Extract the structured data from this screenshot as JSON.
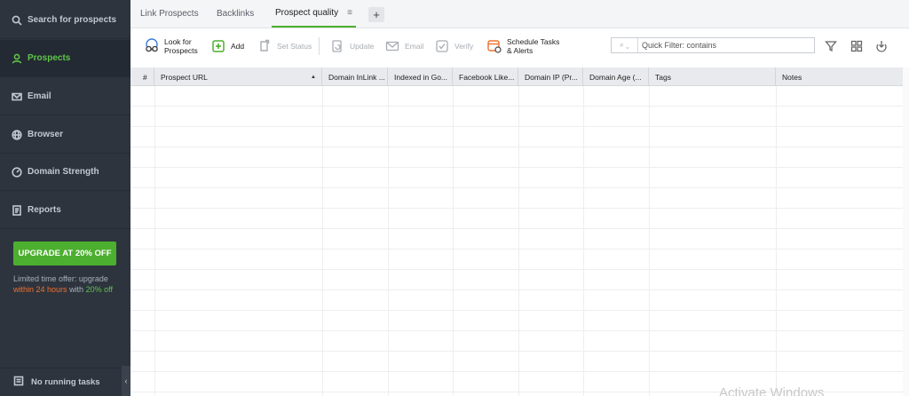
{
  "sidebar": {
    "items": [
      {
        "label": "Search for prospects",
        "icon": "search-icon"
      },
      {
        "label": "Prospects",
        "icon": "user-icon",
        "active": true
      },
      {
        "label": "Email",
        "icon": "mail-icon"
      },
      {
        "label": "Browser",
        "icon": "globe-icon"
      },
      {
        "label": "Domain Strength",
        "icon": "gauge-icon"
      },
      {
        "label": "Reports",
        "icon": "report-icon"
      }
    ],
    "upgrade_button": "UPGRADE AT 20% OFF",
    "offer": {
      "line1": "Limited time offer: upgrade",
      "hours": "within 24 hours",
      "with": "with",
      "percent": "20% off"
    },
    "tasks_status": "No running tasks",
    "collapse_glyph": "‹"
  },
  "tabs": {
    "items": [
      "Link Prospects",
      "Backlinks",
      "Prospect quality"
    ],
    "active_menu_glyph": "≡",
    "add_glyph": "+"
  },
  "toolbar": {
    "look_for_line1": "Look for",
    "look_for_line2": "Prospects",
    "add": "Add",
    "set_status": "Set Status",
    "update": "Update",
    "email": "Email",
    "verify": "Verify",
    "schedule_line1": "Schedule Tasks",
    "schedule_line2": "& Alerts",
    "search_scope": "⌕ ⌄",
    "search_placeholder": "Quick Filter: contains"
  },
  "grid": {
    "columns": [
      "#",
      "Prospect URL",
      "Domain InLink ...",
      "Indexed in Go...",
      "Facebook Like...",
      "Domain IP (Pr...",
      "Domain Age (...",
      "Tags",
      "Notes"
    ],
    "sort_glyph": "▲",
    "rows": []
  },
  "watermark": "Activate Windows",
  "colors": {
    "sidebar_bg": "#2d343e",
    "accent_green": "#4caf2f",
    "active_green": "#5fc44a",
    "orange": "#f0702e"
  }
}
